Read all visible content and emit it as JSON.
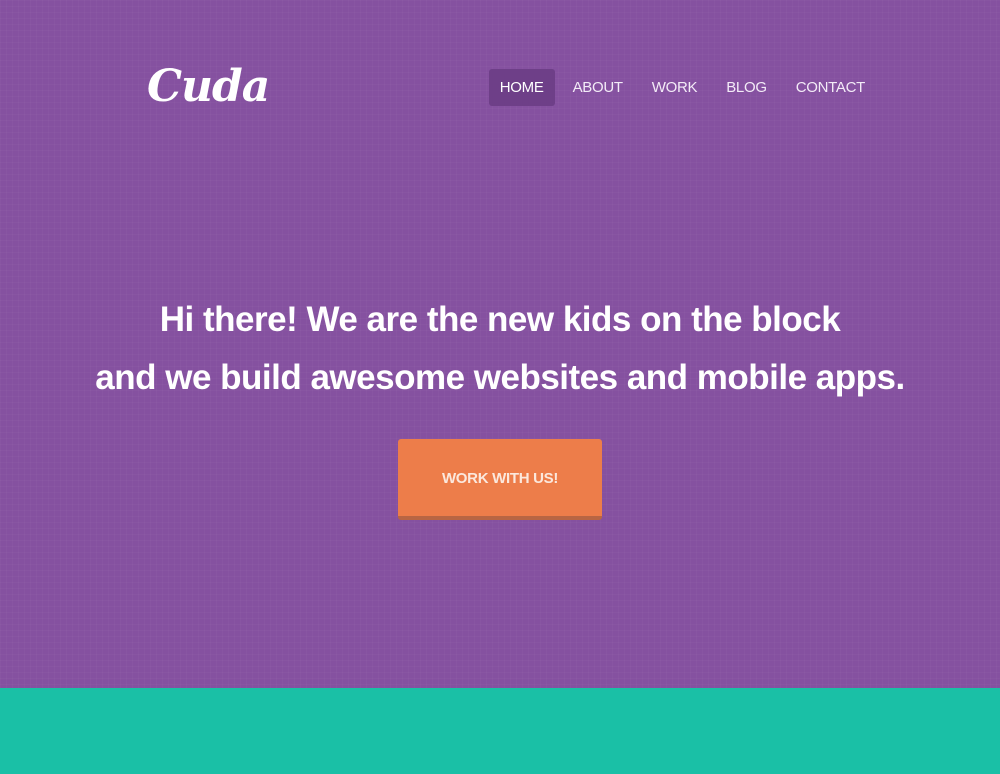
{
  "brand": {
    "logo_text": "Cuda"
  },
  "nav": {
    "items": [
      {
        "label": "HOME",
        "active": true
      },
      {
        "label": "ABOUT",
        "active": false
      },
      {
        "label": "WORK",
        "active": false
      },
      {
        "label": "BLOG",
        "active": false
      },
      {
        "label": "CONTACT",
        "active": false
      }
    ]
  },
  "hero": {
    "headline_line1": "Hi there! We are the new kids on the block",
    "headline_line2": "and we build awesome websites and mobile apps.",
    "cta_label": "WORK WITH US!"
  },
  "colors": {
    "hero_background": "#8551a0",
    "nav_active_background": "#6e3f88",
    "cta_background": "#ed7d4a",
    "section_band": "#1ac0a6",
    "text": "#ffffff"
  }
}
